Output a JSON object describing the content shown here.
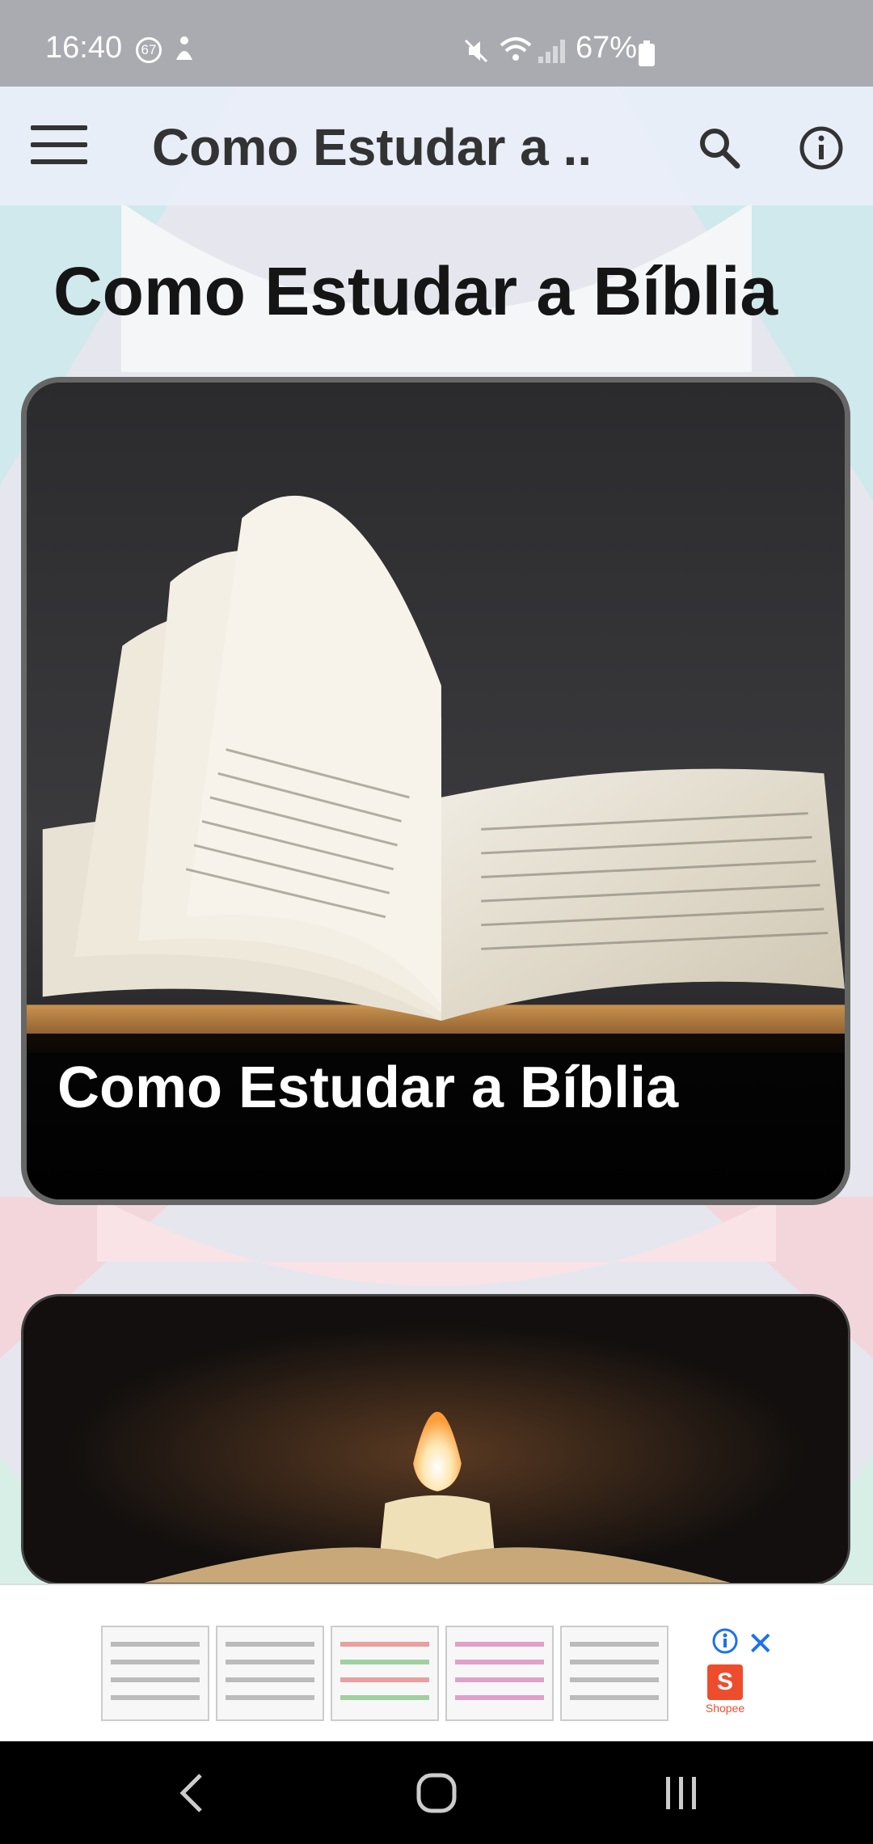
{
  "status_bar": {
    "time": "16:40",
    "notification_badge": "67",
    "battery_percent": "67%"
  },
  "app_bar": {
    "title": "Como Estudar a ...",
    "icons": [
      "menu-icon",
      "search-icon",
      "info-icon"
    ]
  },
  "page": {
    "title": "Como Estudar a Bíblia"
  },
  "cards": [
    {
      "label": "Como Estudar a Bíblia",
      "image": "open-bible-photo"
    },
    {
      "label": "",
      "image": "candle-over-bible-photo"
    }
  ],
  "ad": {
    "brand": "Shopee",
    "brand_glyph": "S",
    "close_glyph": "✕"
  },
  "colors": {
    "status_bar": "#a9abb0",
    "app_bar": "#e9eef8",
    "card_border": "#666666",
    "ad_accent": "#1a73e8",
    "brand": "#ee4d2d"
  }
}
